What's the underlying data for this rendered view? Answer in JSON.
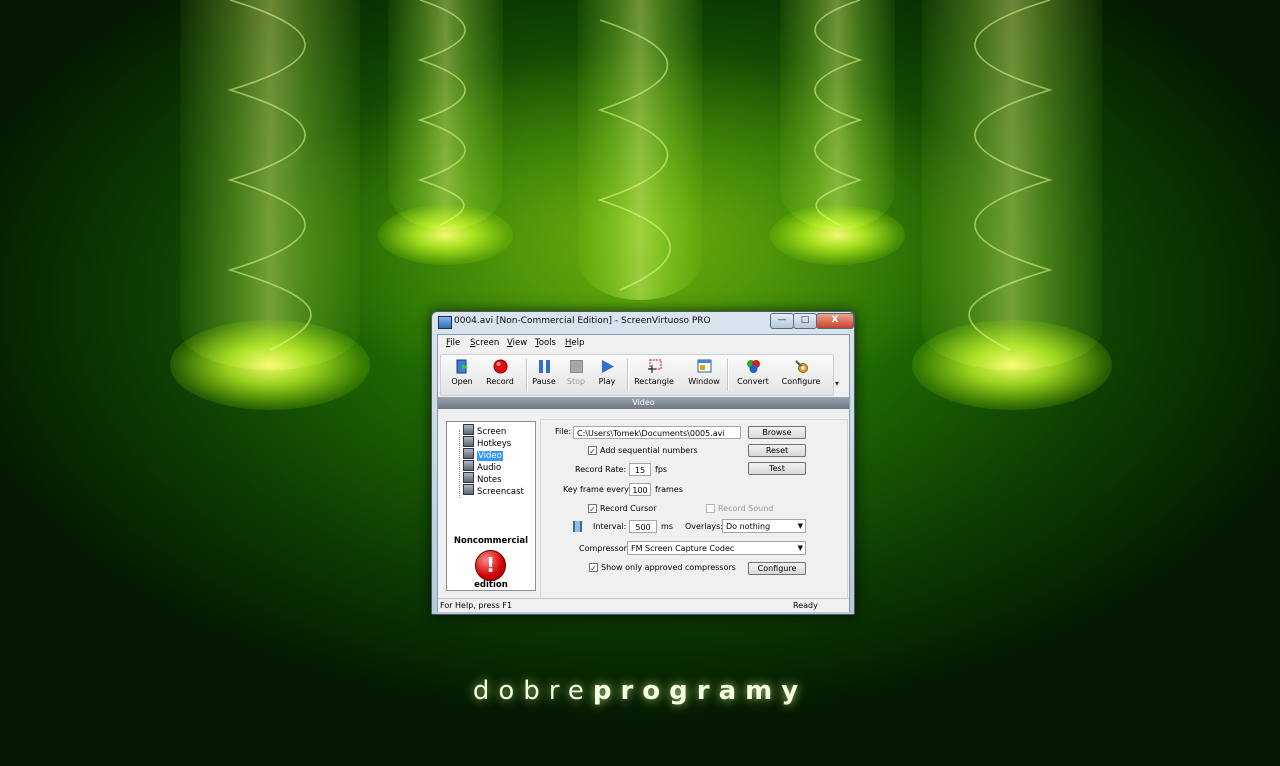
{
  "window": {
    "title": "0004.avi [Non-Commercial Edition] - ScreenVirtuoso PRO",
    "minimize_glyph": "—",
    "maximize_glyph": "□",
    "close_glyph": "X"
  },
  "menu": [
    {
      "key": "F",
      "rest": "ile"
    },
    {
      "key": "S",
      "rest": "creen"
    },
    {
      "key": "V",
      "rest": "iew"
    },
    {
      "key": "T",
      "rest": "ools"
    },
    {
      "key": "H",
      "rest": "elp"
    }
  ],
  "toolbar": {
    "open": "Open",
    "record": "Record",
    "pause": "Pause",
    "stop": "Stop",
    "play": "Play",
    "rectangle": "Rectangle",
    "window": "Window",
    "convert": "Convert",
    "configure": "Configure"
  },
  "section_title": "Video",
  "tree": {
    "items": [
      "Screen",
      "Hotkeys",
      "Video",
      "Audio",
      "Notes",
      "Screencast"
    ],
    "selected": "Video"
  },
  "badge": {
    "line1": "Noncommercial",
    "symbol": "!",
    "line2": "edition"
  },
  "video": {
    "file_label": "File:",
    "file_value": "C:\\Users\\Tomek\\Documents\\0005.avi",
    "browse": "Browse",
    "reset": "Reset",
    "test": "Test",
    "sequential_label": "Add sequential numbers",
    "sequential_checked": true,
    "record_rate_label": "Record Rate:",
    "record_rate": "15",
    "fps": "fps",
    "keyframe_label": "Key frame every:",
    "keyframe": "100",
    "frames": "frames",
    "record_cursor_label": "Record Cursor",
    "record_cursor_checked": true,
    "record_sound_label": "Record Sound",
    "record_sound_checked": false,
    "interval_label": "Interval:",
    "interval": "500",
    "ms": "ms",
    "overlays_label": "Overlays:",
    "overlays_value": "Do nothing",
    "compressor_label": "Compressor:",
    "compressor_value": "FM Screen Capture Codec",
    "approved_label": "Show only approved compressors",
    "approved_checked": true,
    "configure": "Configure",
    "check_glyph": "✓"
  },
  "status": {
    "help": "For Help, press F1",
    "state": "Ready"
  },
  "brand": {
    "part1": "dobre",
    "part2": "programy"
  },
  "colors": {
    "accent_green": "#9be020",
    "selection": "#3399ff",
    "record_red": "#e01010"
  }
}
